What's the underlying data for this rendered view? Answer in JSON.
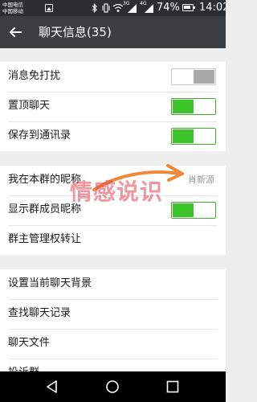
{
  "status_bar": {
    "carrier_1": "中国电信",
    "carrier_2": "中国移动",
    "network_1": "3G",
    "network_2": "4G",
    "battery": "74%",
    "time": "14:02",
    "icons": [
      "image-icon",
      "bluetooth-icon",
      "vibrate-icon",
      "wifi-icon",
      "signal-icon",
      "battery-icon"
    ]
  },
  "header": {
    "title": "聊天信息(35)",
    "back_icon": "back-arrow-icon"
  },
  "group_1": [
    {
      "label": "消息免打扰",
      "toggle": "off"
    },
    {
      "label": "置顶聊天",
      "toggle": "on"
    },
    {
      "label": "保存到通讯录",
      "toggle": "on"
    }
  ],
  "group_2": [
    {
      "label": "我在本群的昵称",
      "value": "肖新源"
    },
    {
      "label": "显示群成员昵称",
      "toggle": "on"
    },
    {
      "label": "群主管理权转让"
    }
  ],
  "group_3": [
    {
      "label": "设置当前聊天背景"
    },
    {
      "label": "查找聊天记录"
    },
    {
      "label": "聊天文件"
    },
    {
      "label": "投诉群"
    }
  ],
  "watermark": {
    "text": "情感说识",
    "color": "#e53f50"
  },
  "colors": {
    "accent_green": "#3cc42a",
    "action_bar": "#3a3e41",
    "status_bar": "#2b2f32",
    "toggle_off_knob": "#a8aaa9"
  },
  "nav_bar": {
    "icons": [
      "back-triangle-icon",
      "home-circle-icon",
      "recents-square-icon"
    ]
  }
}
